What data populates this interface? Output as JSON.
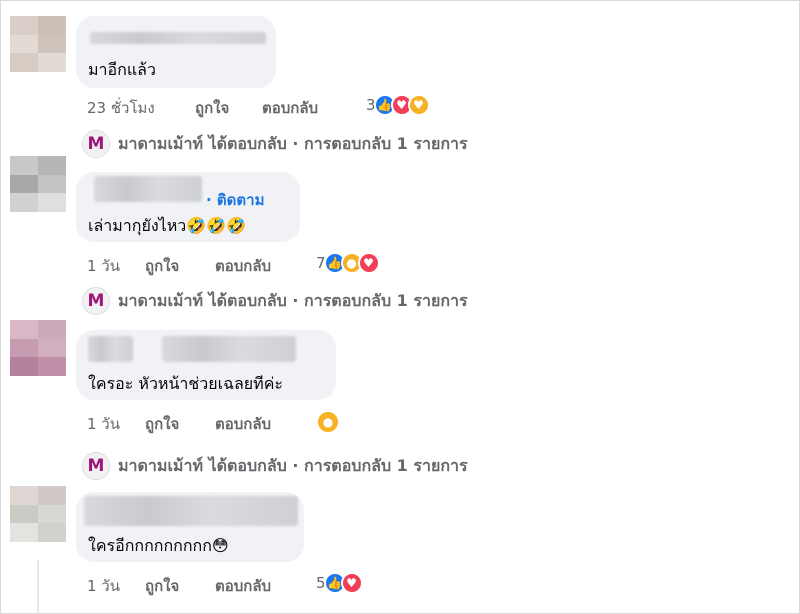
{
  "comments": [
    {
      "text": "มาอีกแล้ว",
      "time": "23 ชั่วโมง",
      "like_label": "ถูกใจ",
      "reply_label": "ตอบกลับ",
      "reaction_count": "3",
      "reactions": [
        "like-icon",
        "love-icon",
        "care-icon"
      ],
      "reply_summary": "มาดามเม้าท์ ได้ตอบกลับ · การตอบกลับ 1 รายการ"
    },
    {
      "follow_label": "· ติดตาม",
      "text": "เล่ามากุยังไหว🤣🤣🤣",
      "time": "1 วัน",
      "like_label": "ถูกใจ",
      "reply_label": "ตอบกลับ",
      "reaction_count": "7",
      "reactions": [
        "like-icon",
        "haha-icon",
        "love-icon"
      ],
      "reply_summary": "มาดามเม้าท์ ได้ตอบกลับ · การตอบกลับ 1 รายการ"
    },
    {
      "text": "ใครอะ หัวหน้าช่วยเฉลยทีค่ะ",
      "time": "1 วัน",
      "like_label": "ถูกใจ",
      "reply_label": "ตอบกลับ",
      "reactions": [
        "haha-icon"
      ],
      "reply_summary": "มาดามเม้าท์ ได้ตอบกลับ · การตอบกลับ 1 รายการ"
    },
    {
      "text": "ใครอีกกกกกกกกก😳",
      "time": "1 วัน",
      "like_label": "ถูกใจ",
      "reply_label": "ตอบกลับ",
      "reaction_count": "5",
      "reactions": [
        "like-icon",
        "love-icon"
      ]
    }
  ],
  "page_logo_letter": "M"
}
